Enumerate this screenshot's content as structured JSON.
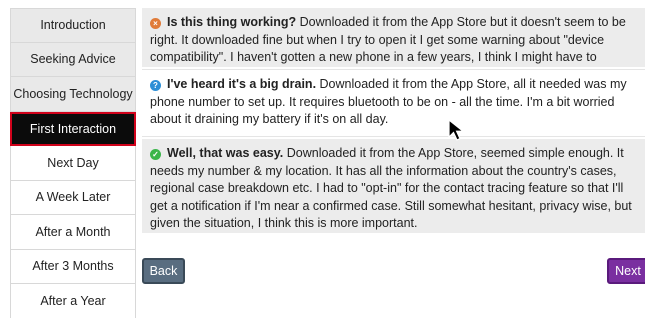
{
  "sidebar": {
    "items": [
      {
        "label": "Introduction"
      },
      {
        "label": "Seeking Advice"
      },
      {
        "label": "Choosing Technology"
      },
      {
        "label": "First Interaction"
      },
      {
        "label": "Next Day"
      },
      {
        "label": "A Week Later"
      },
      {
        "label": "After a Month"
      },
      {
        "label": "After 3 Months"
      },
      {
        "label": "After a Year"
      }
    ],
    "active_index": 3
  },
  "options": [
    {
      "icon": "x-circle-icon",
      "icon_color": "#e07b39",
      "headline": "Is this thing working?",
      "body": " Downloaded it from the App Store but it doesn't seem to be right. It downloaded fine but when I try to open it I get some warning about \"device compatibility\". I haven't gotten a new phone in a few years, I think I might have to upgrade."
    },
    {
      "icon": "question-circle-icon",
      "icon_color": "#2c8fd6",
      "headline": "I've heard it's a big drain.",
      "body": " Downloaded it from the App Store, all it needed was my phone number to set up. It requires bluetooth to be on - all the time. I'm a bit worried about it draining my battery if it's on all day."
    },
    {
      "icon": "check-circle-icon",
      "icon_color": "#3bb54a",
      "headline": "Well, that was easy.",
      "body": " Downloaded it from the App Store, seemed simple enough. It needs my number & my location. It has all the information about the country's cases, regional case breakdown etc. I had to \"opt-in\" for the contact tracing feature so that I'll get a notification if I'm near a confirmed case. Still somewhat hesitant, privacy wise, but given the situation, I think this is more important."
    }
  ],
  "buttons": {
    "back_label": "Back",
    "next_label": "Next"
  },
  "icons": {
    "x": "×",
    "q": "?",
    "c": "✓"
  }
}
